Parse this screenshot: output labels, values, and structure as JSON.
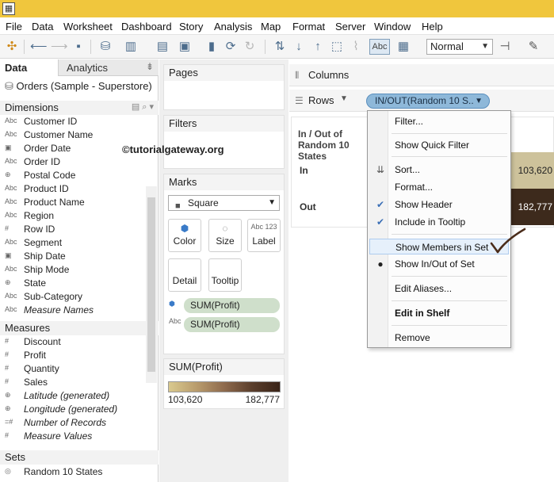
{
  "menu": [
    "File",
    "Data",
    "Worksheet",
    "Dashboard",
    "Story",
    "Analysis",
    "Map",
    "Format",
    "Server",
    "Window",
    "Help"
  ],
  "toolbar": {
    "abc_label": "Abc",
    "fit_value": "Normal"
  },
  "left_pane": {
    "tabs": {
      "data": "Data",
      "analytics": "Analytics"
    },
    "datasource": "Orders (Sample - Superstore)",
    "dimensions_header": "Dimensions",
    "dimensions": [
      {
        "icon": "Abc",
        "label": "Customer ID"
      },
      {
        "icon": "Abc",
        "label": "Customer Name"
      },
      {
        "icon": "cal",
        "label": "Order Date"
      },
      {
        "icon": "Abc",
        "label": "Order ID"
      },
      {
        "icon": "globe",
        "label": "Postal Code"
      },
      {
        "icon": "Abc",
        "label": "Product ID"
      },
      {
        "icon": "Abc",
        "label": "Product Name"
      },
      {
        "icon": "Abc",
        "label": "Region"
      },
      {
        "icon": "#",
        "label": "Row ID"
      },
      {
        "icon": "Abc",
        "label": "Segment"
      },
      {
        "icon": "cal",
        "label": "Ship Date"
      },
      {
        "icon": "Abc",
        "label": "Ship Mode"
      },
      {
        "icon": "globe",
        "label": "State"
      },
      {
        "icon": "Abc",
        "label": "Sub-Category"
      },
      {
        "icon": "Abc",
        "label": "Measure Names"
      }
    ],
    "measures_header": "Measures",
    "measures": [
      {
        "icon": "#",
        "label": "Discount"
      },
      {
        "icon": "#",
        "label": "Profit"
      },
      {
        "icon": "#",
        "label": "Quantity"
      },
      {
        "icon": "#",
        "label": "Sales"
      },
      {
        "icon": "globe",
        "label": "Latitude (generated)"
      },
      {
        "icon": "globe",
        "label": "Longitude (generated)"
      },
      {
        "icon": "=#",
        "label": "Number of Records"
      },
      {
        "icon": "#",
        "label": "Measure Values"
      }
    ],
    "sets_header": "Sets",
    "sets": [
      {
        "label": "Random 10 States"
      }
    ]
  },
  "cards": {
    "pages": "Pages",
    "filters": "Filters",
    "marks": "Marks",
    "mark_type": "Square",
    "buttons": {
      "color": "Color",
      "size": "Size",
      "label": "Label",
      "detail": "Detail",
      "tooltip": "Tooltip"
    },
    "pills": [
      "SUM(Profit)",
      "SUM(Profit)"
    ],
    "legend_title": "SUM(Profit)",
    "legend_min": "103,620",
    "legend_max": "182,777"
  },
  "shelves": {
    "columns": "Columns",
    "rows": "Rows",
    "rows_pill": "IN/OUT(Random 10 S.."
  },
  "view": {
    "header": "In / Out of Random 10 States",
    "rows": [
      {
        "label": "In",
        "value": "103,620",
        "color": "#cdc29b"
      },
      {
        "label": "Out",
        "value": "182,777",
        "color": "#3d2a1c"
      }
    ]
  },
  "context_menu": {
    "filter": "Filter...",
    "quick_filter": "Show Quick Filter",
    "sort": "Sort...",
    "format": "Format...",
    "show_header": "Show Header",
    "include_tooltip": "Include in Tooltip",
    "show_members": "Show Members in Set",
    "show_inout": "Show In/Out of Set",
    "edit_aliases": "Edit Aliases...",
    "edit_shelf": "Edit in Shelf",
    "remove": "Remove"
  },
  "watermark": "©tutorialgateway.org"
}
